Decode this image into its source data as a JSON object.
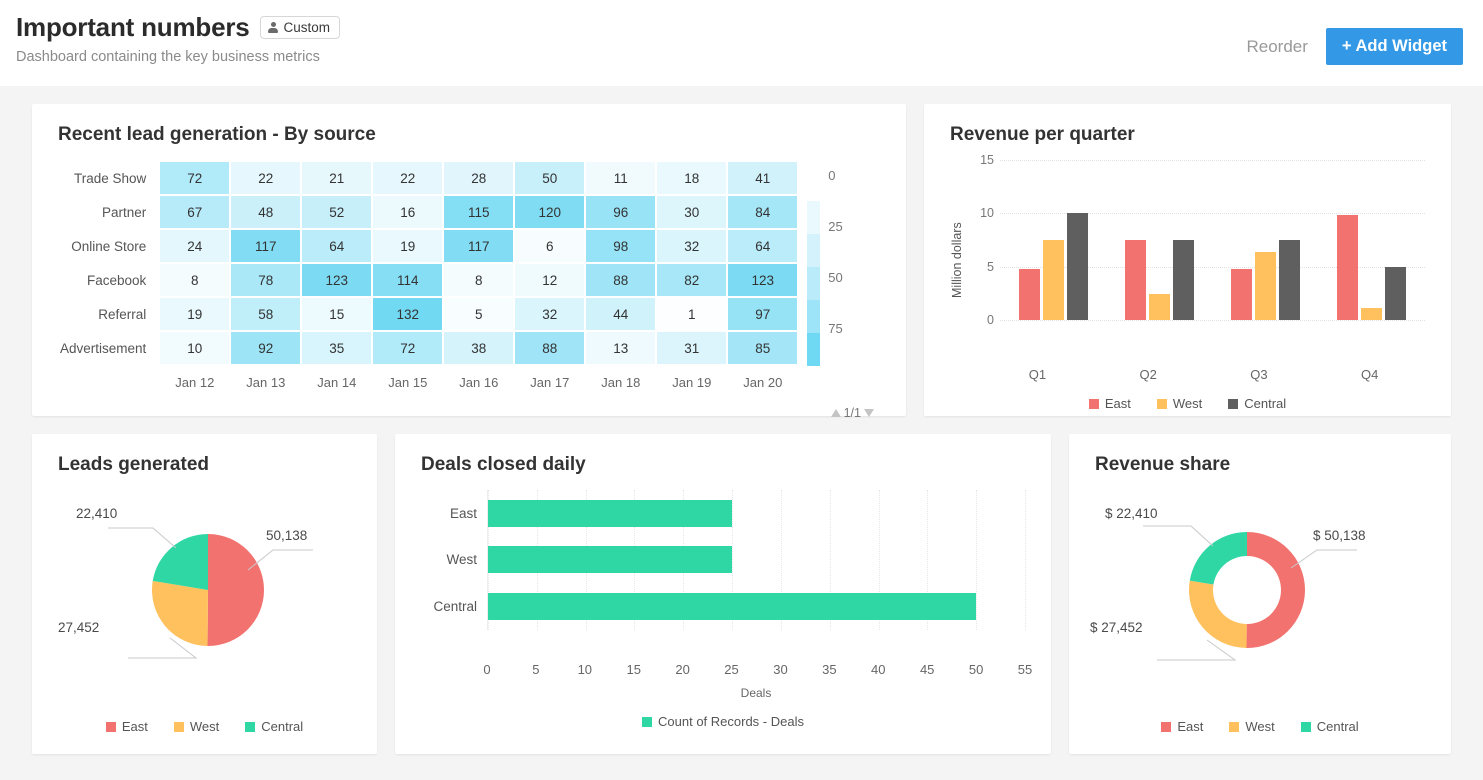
{
  "header": {
    "title": "Important numbers",
    "badge_label": "Custom",
    "badge_icon": "person-icon",
    "subtitle": "Dashboard containing the key business metrics",
    "reorder_label": "Reorder",
    "add_widget_label": "+ Add Widget",
    "accent_color": "#3399e6"
  },
  "colors": {
    "east": "#f2726f",
    "west": "#ffc15e",
    "central_bar": "#5f5f5f",
    "central_pie": "#2fd7a5",
    "green": "#2fd7a5",
    "heat_low": "#fdfeff",
    "heat_high": "#6fd8f2"
  },
  "widgets": {
    "heatmap": {
      "title": "Recent lead generation - By source",
      "rows": [
        "Trade Show",
        "Partner",
        "Online Store",
        "Facebook",
        "Referral",
        "Advertisement"
      ],
      "columns": [
        "Jan 12",
        "Jan 13",
        "Jan 14",
        "Jan 15",
        "Jan 16",
        "Jan 17",
        "Jan 18",
        "Jan 19",
        "Jan 20"
      ],
      "legend_ticks": [
        "0",
        "25",
        "50",
        "75"
      ],
      "pager_label": "1/1"
    },
    "revenue_quarter": {
      "title": "Revenue per quarter"
    },
    "leads_generated": {
      "title": "Leads generated"
    },
    "deals_closed": {
      "title": "Deals closed daily"
    },
    "revenue_share": {
      "title": "Revenue share"
    }
  },
  "chart_data": [
    {
      "type": "heatmap",
      "title": "Recent lead generation - By source",
      "rows": [
        "Trade Show",
        "Partner",
        "Online Store",
        "Facebook",
        "Referral",
        "Advertisement"
      ],
      "columns": [
        "Jan 12",
        "Jan 13",
        "Jan 14",
        "Jan 15",
        "Jan 16",
        "Jan 17",
        "Jan 18",
        "Jan 19",
        "Jan 20"
      ],
      "values": [
        [
          72,
          22,
          21,
          22,
          28,
          50,
          11,
          18,
          41
        ],
        [
          67,
          48,
          52,
          16,
          115,
          120,
          96,
          30,
          84
        ],
        [
          24,
          117,
          64,
          19,
          117,
          6,
          98,
          32,
          64
        ],
        [
          8,
          78,
          123,
          114,
          8,
          12,
          88,
          82,
          123
        ],
        [
          19,
          58,
          15,
          132,
          5,
          32,
          44,
          1,
          97
        ],
        [
          10,
          92,
          35,
          72,
          38,
          88,
          13,
          31,
          85
        ]
      ],
      "colorbar_ticks": [
        0,
        25,
        50,
        75
      ],
      "colorscale": [
        "#fdfeff",
        "#6fd8f2"
      ]
    },
    {
      "type": "bar",
      "title": "Revenue per quarter",
      "categories": [
        "Q1",
        "Q2",
        "Q3",
        "Q4"
      ],
      "series": [
        {
          "name": "East",
          "values": [
            4.8,
            7.5,
            4.8,
            9.8
          ],
          "color": "#f2726f"
        },
        {
          "name": "West",
          "values": [
            7.5,
            2.4,
            6.4,
            1.1
          ],
          "color": "#ffc15e"
        },
        {
          "name": "Central",
          "values": [
            10.0,
            7.5,
            7.5,
            5.0
          ],
          "color": "#5f5f5f"
        }
      ],
      "xlabel": "",
      "ylabel": "Million dollars",
      "ylim": [
        0,
        15
      ],
      "yticks": [
        0,
        5,
        10,
        15
      ],
      "grid": true,
      "legend_position": "bottom"
    },
    {
      "type": "pie",
      "title": "Leads generated",
      "labels": [
        "East",
        "West",
        "Central"
      ],
      "values": [
        50138,
        27452,
        22410
      ],
      "display_labels": [
        "50,138",
        "27,452",
        "22,410"
      ],
      "colors": [
        "#f2726f",
        "#ffc15e",
        "#2fd7a5"
      ],
      "legend_position": "bottom"
    },
    {
      "type": "bar",
      "orientation": "horizontal",
      "title": "Deals closed daily",
      "categories": [
        "East",
        "West",
        "Central"
      ],
      "values": [
        25,
        25,
        50
      ],
      "series": [
        {
          "name": "Count of Records - Deals",
          "values": [
            25,
            25,
            50
          ],
          "color": "#2fd7a5"
        }
      ],
      "xlabel": "Deals",
      "ylabel": "",
      "xlim": [
        0,
        55
      ],
      "xticks": [
        0,
        5,
        10,
        15,
        20,
        25,
        30,
        35,
        40,
        45,
        50,
        55
      ],
      "grid": true,
      "legend_position": "bottom"
    },
    {
      "type": "pie",
      "variant": "donut",
      "title": "Revenue share",
      "labels": [
        "East",
        "West",
        "Central"
      ],
      "values": [
        50138,
        27452,
        22410
      ],
      "display_labels": [
        "$ 50,138",
        "$ 27,452",
        "$ 22,410"
      ],
      "colors": [
        "#f2726f",
        "#ffc15e",
        "#2fd7a5"
      ],
      "legend_position": "bottom"
    }
  ],
  "legends": {
    "regions": [
      "East",
      "West",
      "Central"
    ],
    "deals_series": "Count of Records - Deals"
  }
}
